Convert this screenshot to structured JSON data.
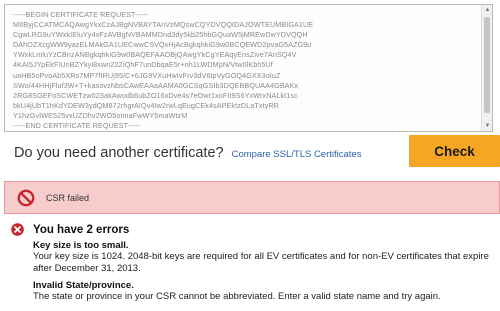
{
  "csr": {
    "text": "-----BEGIN CERTIFICATE REQUEST-----\nMIIByjCCATMCAQAwgYkxCzAJBgNVBAYTAnVzMQswCQYDVQQIDAJOWTEUMBIGA1UE\nCgwLRG9uYWxkIEluYy4xFzAVBgNVBAMMDnd3dy5kb25hbGQuaW5jMREwDwYDVQQH\nDAhOZXcgWW9yazELMAkGA1UECwwCSVQxHjAcBgkqhkiG9w0BCQEWD2pvaG5AZG9u\nYWxkLmluYzCBnzANBgkqhkiG9w0BAQEFAAOBjQAwgYkCgYEAqyEnsZive7AnSQ4V\n4KAI5JYpEkFIUnBZYkyi8xwn22ZiQhF7unDbqaE5r+nh1LWDMpN/Vtw0lKbh5Uf\nuaHB5oPvoAb5XRs7MP7fIRUj95/C+6JG9VXuHwIvFrv3dV6tpVyGOQ4GXX3oIuZ\nSWo/44HHjFluf3W+T+kasovzNbsCAwEAAaAAMA0GCSqGSIb3DQEBBQUAA4GBAKx\n2RG8SGEFoSCWETzw023akAwodb6ubZO16xDve4s7eOwr1xoFIt9S6YxWrxNALkI1sc\nbkU4jUbT1hKdYDEW3ydQM872rhgrAIQv4Iw2rwLqEugCEk4sAPEktzDLaTxtyRR\nY1hzGvIWE525vxUZDhv2WO5oImaFwWY5maWtzM\n-----END CERTIFICATE REQUEST-----"
  },
  "prompt": {
    "question": "Do you need another certificate?",
    "compare_link": "Compare SSL/TLS Certificates"
  },
  "check_button": {
    "label": "Check"
  },
  "status_bar": {
    "label": "CSR failed",
    "icon": "prohibited-icon",
    "background": "#f6cccd",
    "icon_color": "#c8252c"
  },
  "errors": {
    "title": "You have 2 errors",
    "icon": "prohibited-icon",
    "items": [
      {
        "heading": "Key size is too small.",
        "description": "Your key size is 1024. 2048-bit keys are required for all EV certificates and for non-EV certificates that expire after December 31, 2013."
      },
      {
        "heading": "Invalid State/province.",
        "description": "The state or province in your CSR cannot be abbreviated. Enter a valid state name and try again."
      }
    ]
  },
  "colors": {
    "accent": "#f5a623",
    "link": "#2f5fa7",
    "error": "#c8252c"
  }
}
